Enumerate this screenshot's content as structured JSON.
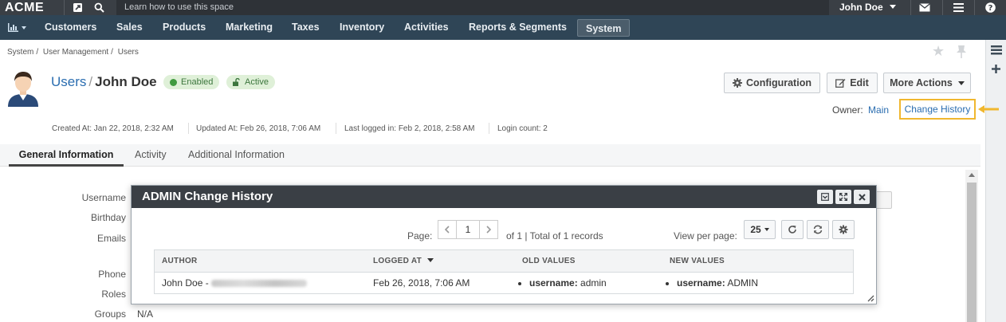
{
  "topbar": {
    "brand": "ACME",
    "hint": "Learn how to use this space",
    "user": "John Doe"
  },
  "nav": {
    "items": [
      "Customers",
      "Sales",
      "Products",
      "Marketing",
      "Taxes",
      "Inventory",
      "Activities",
      "Reports & Segments",
      "System"
    ],
    "active": "System"
  },
  "breadcrumb": [
    "System",
    "User Management",
    "Users"
  ],
  "header": {
    "section": "Users",
    "separator": "/",
    "name": "John Doe",
    "status_enabled": "Enabled",
    "status_active": "Active"
  },
  "actions": {
    "configuration": "Configuration",
    "edit": "Edit",
    "more": "More Actions"
  },
  "owner": {
    "label": "Owner:",
    "value": "Main"
  },
  "change_history_link": "Change History",
  "meta": {
    "created": "Created At: Jan 22, 2018, 2:32 AM",
    "updated": "Updated At: Feb 26, 2018, 7:06 AM",
    "last_login": "Last logged in: Feb 2, 2018, 2:58 AM",
    "login_count": "Login count: 2"
  },
  "tabs": [
    "General Information",
    "Activity",
    "Additional Information"
  ],
  "fields": {
    "labels": [
      "Username",
      "Birthday",
      "Emails",
      "Phone",
      "Roles",
      "Groups"
    ],
    "groups_value": "N/A"
  },
  "dialog": {
    "title": "ADMIN Change History",
    "page_label": "Page:",
    "page_value": "1",
    "page_total": "of 1 | Total of 1 records",
    "view_per_page_label": "View per page:",
    "view_per_page_value": "25",
    "columns": [
      "AUTHOR",
      "LOGGED AT",
      "OLD VALUES",
      "NEW VALUES"
    ],
    "rows": [
      {
        "author": "John Doe -",
        "logged_at": "Feb 26, 2018, 7:06 AM",
        "old_key": "username:",
        "old_value": "admin",
        "new_key": "username:",
        "new_value": "ADMIN"
      }
    ]
  },
  "colors": {
    "topbar": "#3a3f45",
    "navbar": "#2f4556",
    "link": "#2a6db0",
    "highlight": "#f0b72f",
    "badge_bg": "#dff0d8",
    "badge_fg": "#3c763d"
  }
}
